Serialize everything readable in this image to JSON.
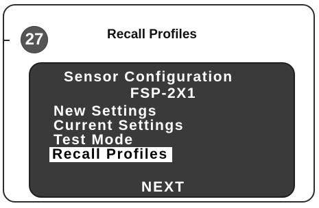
{
  "step": {
    "number": "27",
    "title": "Recall Profiles"
  },
  "screen": {
    "title": "Sensor Configuration",
    "subtitle": "FSP-2X1",
    "menu_items": [
      {
        "label": "New Settings",
        "selected": false
      },
      {
        "label": "Current Settings",
        "selected": false
      },
      {
        "label": "Test Mode",
        "selected": false
      },
      {
        "label": "Recall Profiles",
        "selected": true
      }
    ],
    "next_label": "NEXT"
  },
  "colors": {
    "screen_bg": "#3a3a3a",
    "badge_bg": "#555555",
    "text_on_screen": "#ffffff",
    "highlight_bg": "#ffffff"
  }
}
